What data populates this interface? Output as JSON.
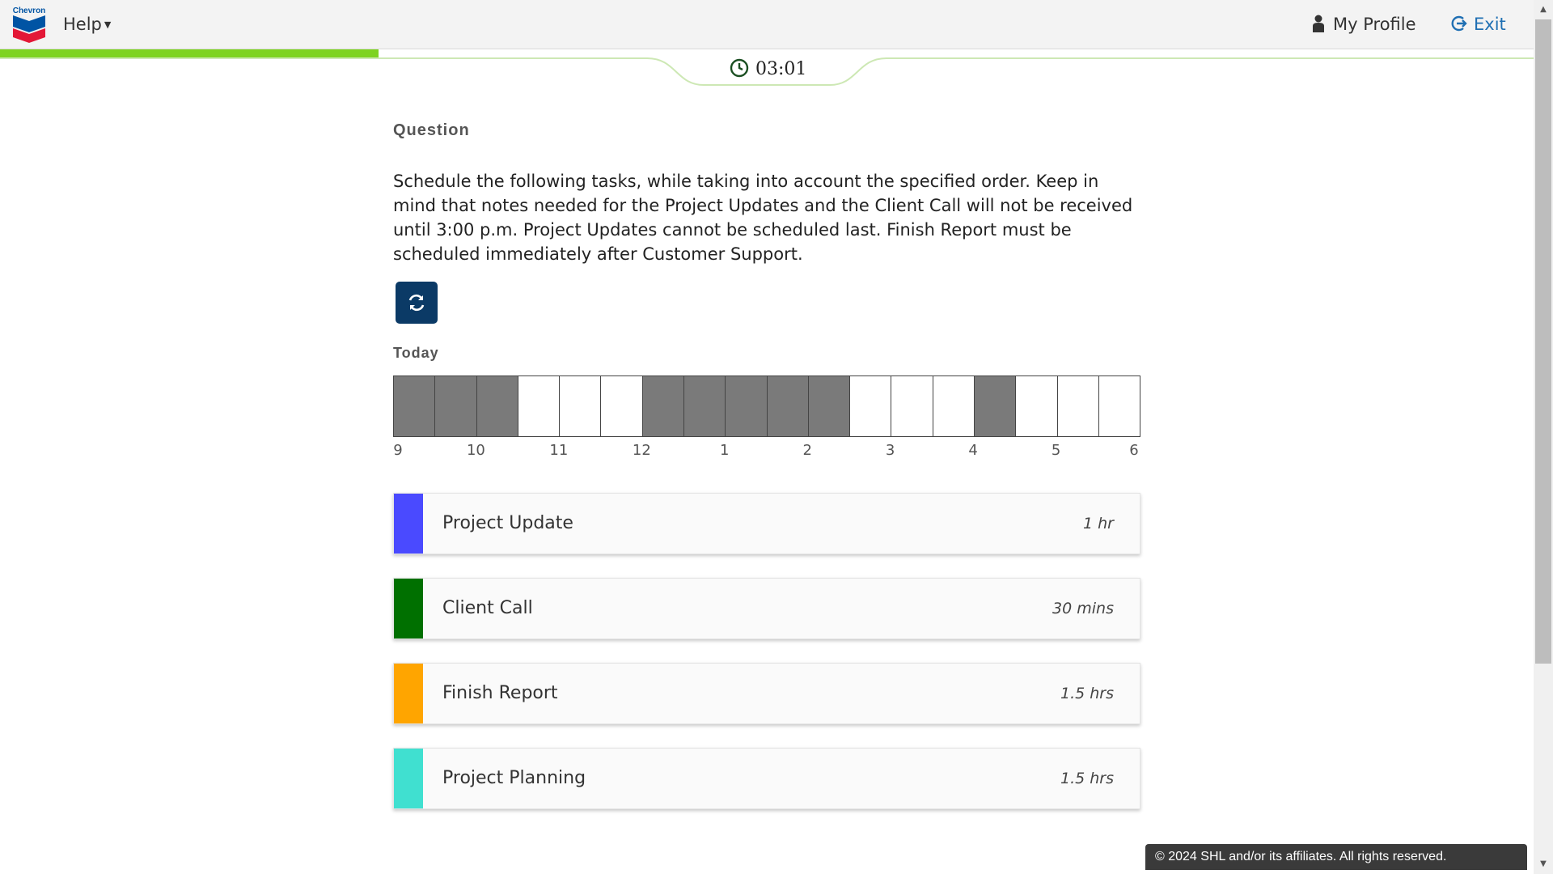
{
  "header": {
    "brand": "Chevron",
    "help_label": "Help",
    "profile_label": "My Profile",
    "exit_label": "Exit"
  },
  "progress": {
    "fraction": 0.247
  },
  "timer": {
    "value": "03:01"
  },
  "question": {
    "heading": "Question",
    "text": "Schedule the following tasks, while taking into account the specified order. Keep in mind that notes needed for the Project Updates and the Client Call will not be received until 3:00 p.m. Project Updates cannot be scheduled last. Finish Report must be scheduled immediately after Customer Support."
  },
  "schedule": {
    "label": "Today",
    "hours": [
      "9",
      "10",
      "11",
      "12",
      "1",
      "2",
      "3",
      "4",
      "5",
      "6"
    ],
    "slots": [
      1,
      1,
      1,
      0,
      0,
      0,
      1,
      1,
      1,
      1,
      1,
      0,
      0,
      0,
      1,
      0,
      0,
      0
    ]
  },
  "tasks": [
    {
      "name": "Project Update",
      "duration": "1 hr",
      "color": "#4a4aff"
    },
    {
      "name": "Client Call",
      "duration": "30 mins",
      "color": "#007000"
    },
    {
      "name": "Finish Report",
      "duration": "1.5 hrs",
      "color": "#ffa500"
    },
    {
      "name": "Project Planning",
      "duration": "1.5 hrs",
      "color": "#40e0d0"
    }
  ],
  "footer": {
    "text": "© 2024 SHL and/or its affiliates. All rights reserved."
  },
  "colors": {
    "accent": "#0b3a66",
    "progress": "#7ed321",
    "link": "#1f6fb3",
    "filled_slot": "#7a7a7a"
  },
  "icons": {
    "logo": "chevron-logo-icon",
    "help_caret": "caret-down-icon",
    "profile": "user-icon",
    "exit": "exit-icon",
    "timer": "clock-icon",
    "reset": "refresh-icon"
  }
}
